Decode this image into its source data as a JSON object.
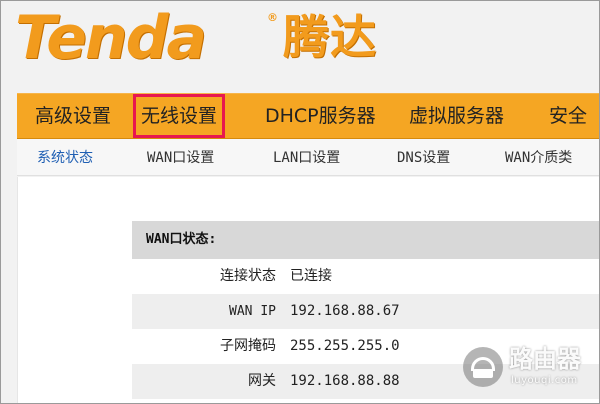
{
  "brand": {
    "logo_text": "Tenda",
    "registered_mark": "®",
    "chinese_name": "腾达"
  },
  "nav": {
    "items": [
      {
        "label": "高级设置"
      },
      {
        "label": "无线设置",
        "highlighted": true
      },
      {
        "label": "DHCP服务器"
      },
      {
        "label": "虚拟服务器"
      },
      {
        "label": "安全"
      }
    ]
  },
  "subnav": {
    "items": [
      {
        "label": "系统状态",
        "active": true
      },
      {
        "label": "WAN口设置"
      },
      {
        "label": "LAN口设置"
      },
      {
        "label": "DNS设置"
      },
      {
        "label": "WAN介质类"
      }
    ]
  },
  "wan_status": {
    "title": "WAN口状态:",
    "rows": [
      {
        "label": "连接状态",
        "value": "已连接"
      },
      {
        "label": "WAN IP",
        "value": "192.168.88.67"
      },
      {
        "label": "子网掩码",
        "value": "255.255.255.0"
      },
      {
        "label": "网关",
        "value": "192.168.88.88"
      }
    ]
  },
  "watermark": {
    "text": "路由器",
    "subtext": "luyouqi.com"
  },
  "colors": {
    "brand_orange": "#f29b1d",
    "nav_bg": "#f5a623",
    "highlight_border": "#e8174f",
    "active_subnav": "#1f5fb3"
  }
}
